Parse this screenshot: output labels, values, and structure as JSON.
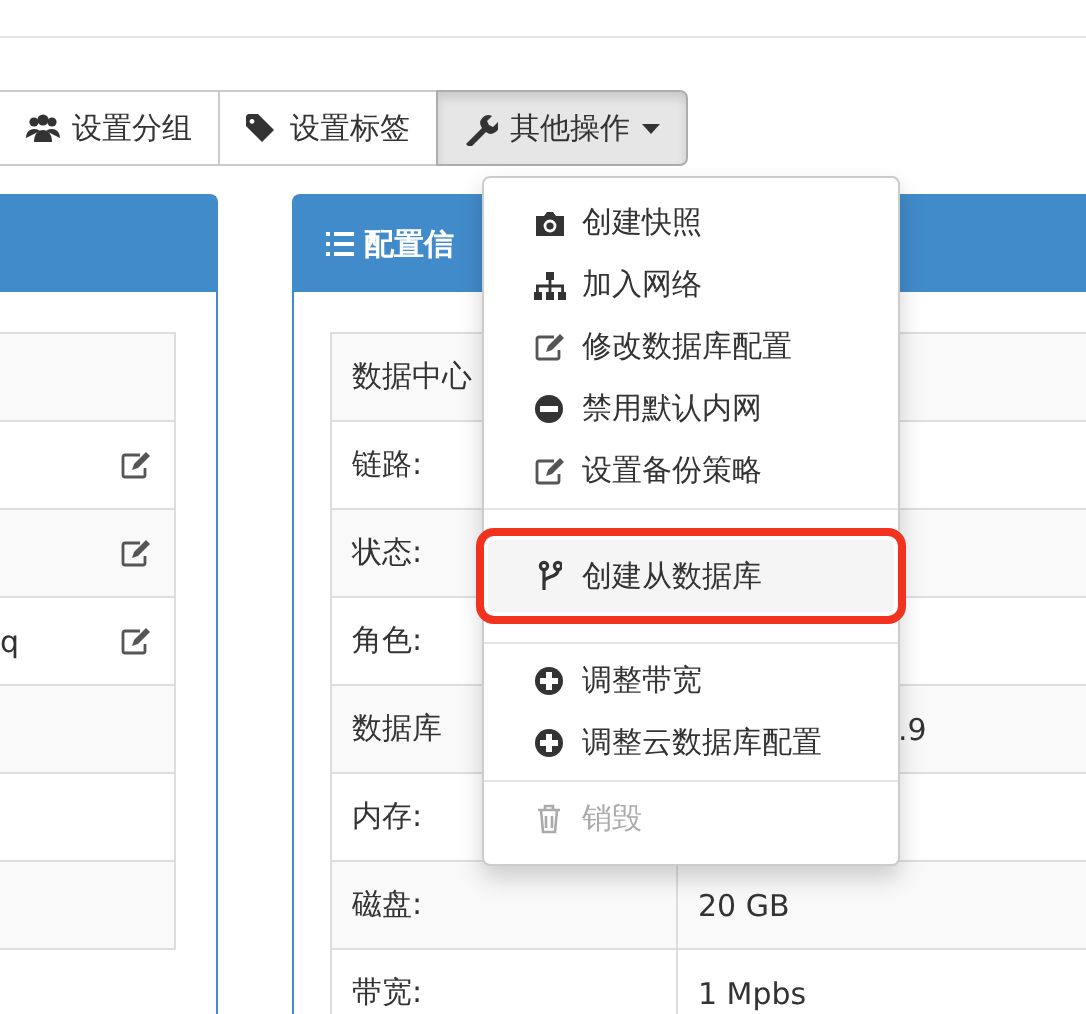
{
  "toolbar": {
    "buttons": [
      {
        "label": "设置分组",
        "active": false
      },
      {
        "label": "设置标签",
        "active": false
      },
      {
        "label": "其他操作",
        "active": true,
        "caret": true
      }
    ]
  },
  "left_panel": {
    "rows": [
      {
        "editable": false
      },
      {
        "editable": true
      },
      {
        "editable": true
      },
      {
        "text": "q",
        "editable": true
      },
      {
        "editable": false
      },
      {
        "editable": false
      },
      {
        "editable": false
      }
    ]
  },
  "config_panel": {
    "title": "配置信",
    "rows": [
      {
        "label": "数据中心"
      },
      {
        "label": "链路:"
      },
      {
        "label": "状态:"
      },
      {
        "label": "角色:"
      },
      {
        "label": "数据库",
        "value": ".9"
      },
      {
        "label": "内存:"
      },
      {
        "label": "磁盘:",
        "value": "20 GB"
      },
      {
        "label": "带宽:",
        "value": "1 Mpbs"
      }
    ]
  },
  "dropdown_menu": {
    "sections": [
      [
        {
          "label": "创建快照",
          "disabled": false,
          "highlighted": false
        },
        {
          "label": "加入网络",
          "disabled": false,
          "highlighted": false
        },
        {
          "label": "修改数据库配置",
          "disabled": false,
          "highlighted": false
        },
        {
          "label": "禁用默认内网",
          "disabled": false,
          "highlighted": false
        },
        {
          "label": "设置备份策略",
          "disabled": false,
          "highlighted": false
        }
      ],
      [
        {
          "label": "创建从数据库",
          "disabled": false,
          "highlighted": true
        }
      ],
      [
        {
          "label": "调整带宽",
          "disabled": false,
          "highlighted": false
        },
        {
          "label": "调整云数据库配置",
          "disabled": false,
          "highlighted": false
        }
      ],
      [
        {
          "label": "销毁",
          "disabled": true,
          "highlighted": false
        }
      ]
    ]
  }
}
